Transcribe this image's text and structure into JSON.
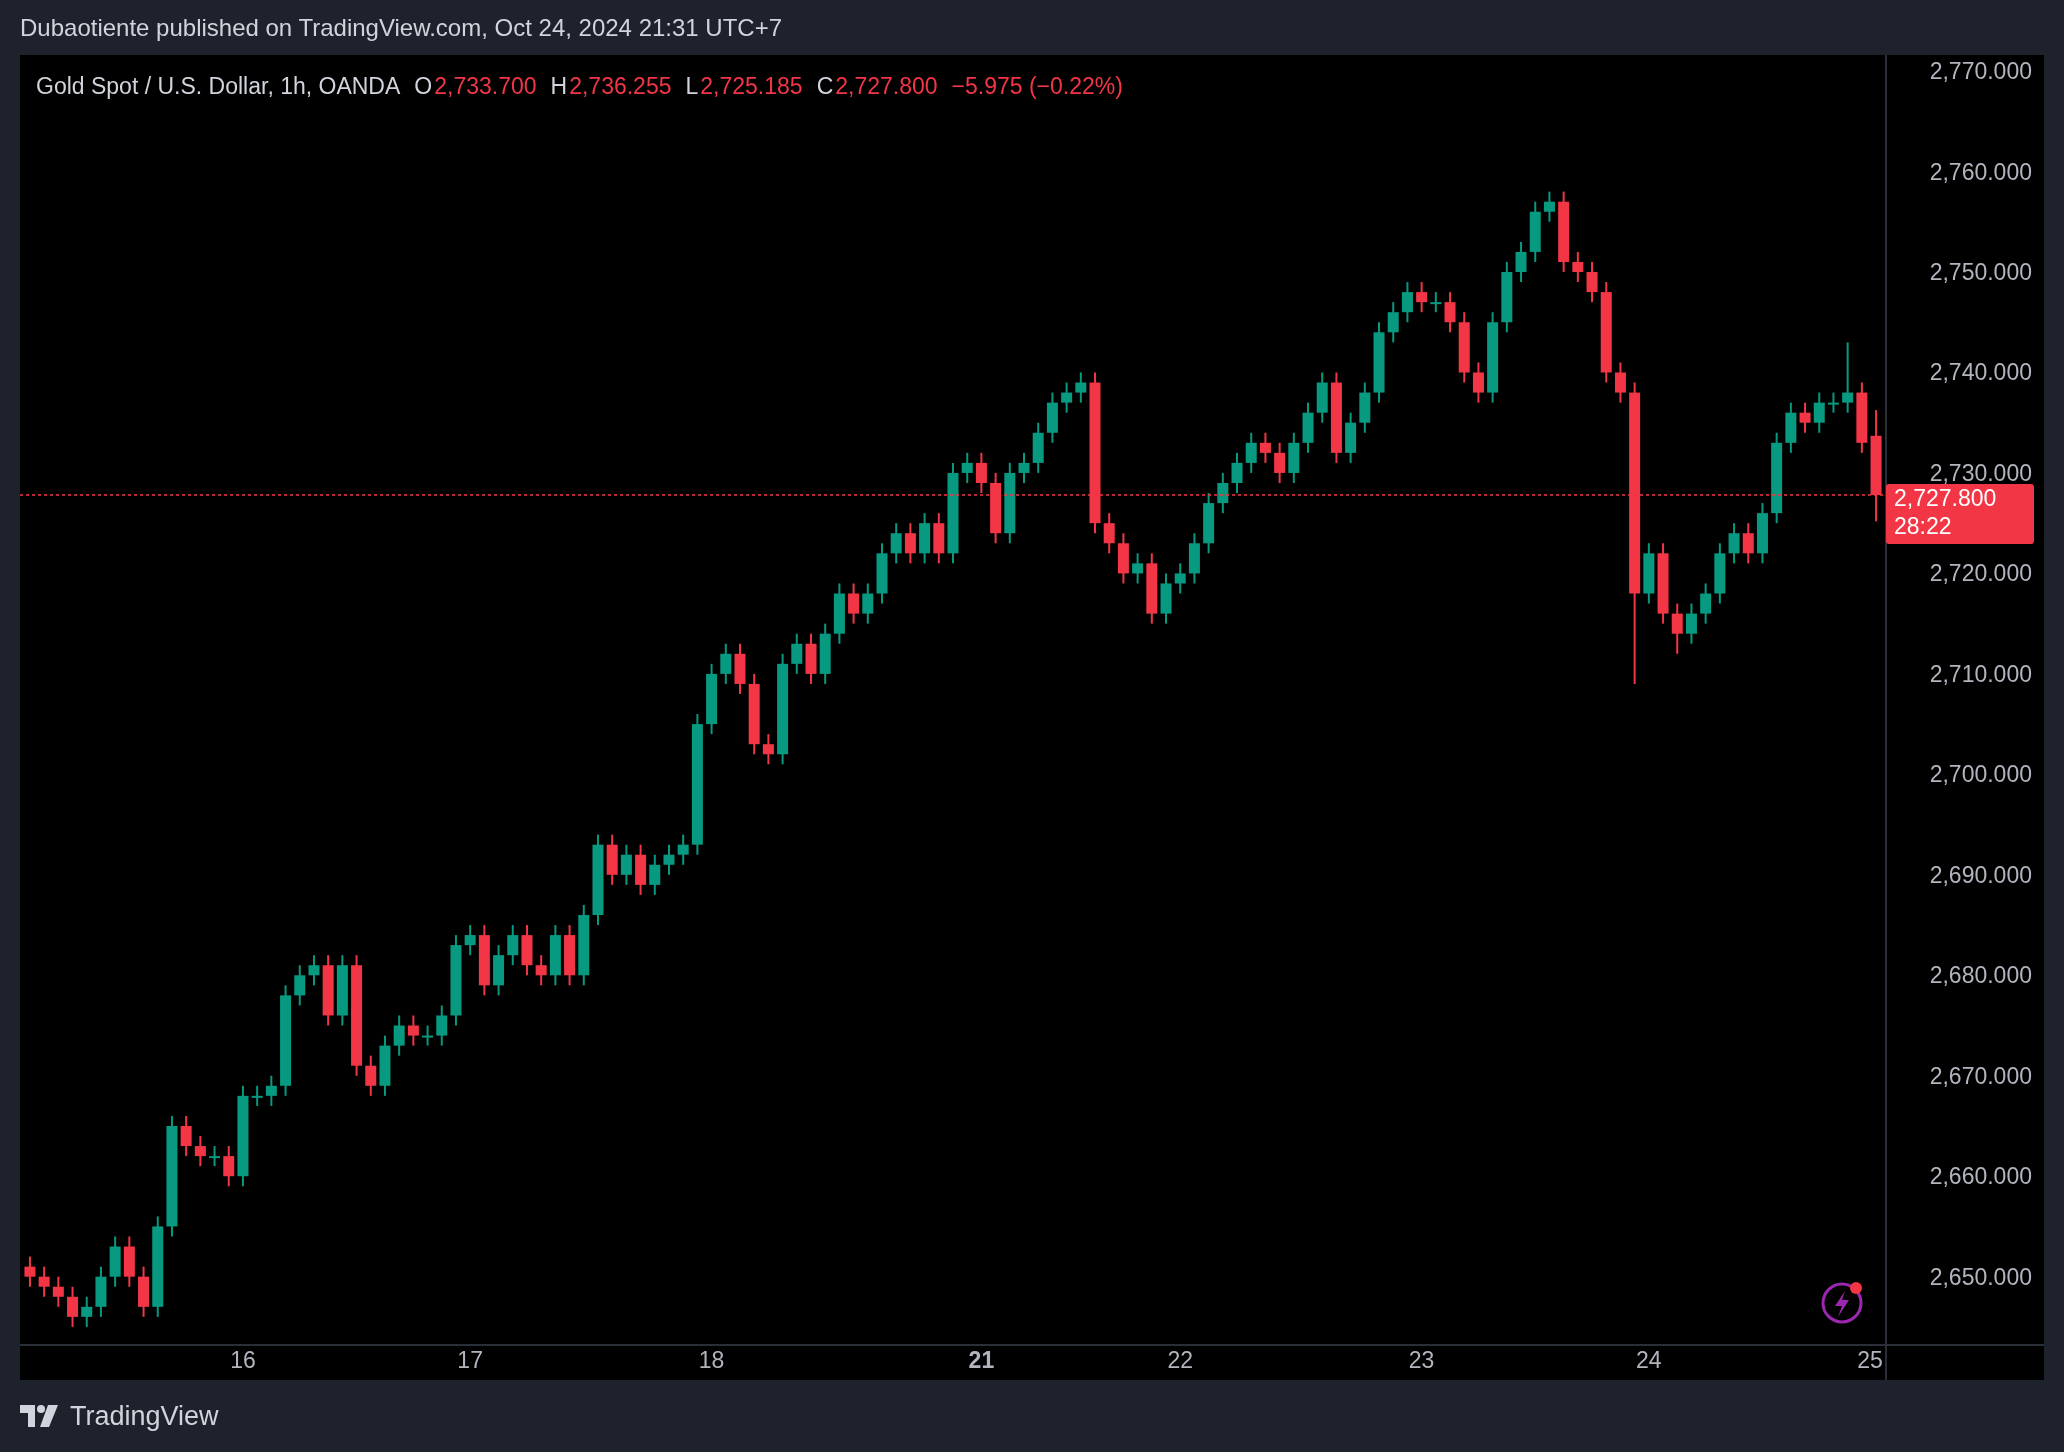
{
  "header": {
    "text": "Dubaotiente published on TradingView.com, Oct 24, 2024 21:31 UTC+7"
  },
  "legend": {
    "symbol": "Gold Spot / U.S. Dollar, 1h, OANDA",
    "fields": [
      {
        "key": "O",
        "value": "2,733.700"
      },
      {
        "key": "H",
        "value": "2,736.255"
      },
      {
        "key": "L",
        "value": "2,725.185"
      },
      {
        "key": "C",
        "value": "2,727.800"
      }
    ],
    "change": "−5.975 (−0.22%)"
  },
  "chart": {
    "chart_data": {
      "type": "candlestick",
      "categories": [
        null,
        null,
        null,
        null,
        null,
        null,
        null,
        null,
        null,
        null,
        null,
        null,
        null,
        null,
        null,
        "16",
        null,
        null,
        null,
        null,
        null,
        null,
        null,
        null,
        null,
        null,
        null,
        null,
        null,
        null,
        null,
        "17",
        null,
        null,
        null,
        null,
        null,
        null,
        null,
        null,
        null,
        null,
        null,
        null,
        null,
        null,
        null,
        null,
        "18",
        null,
        null,
        null,
        null,
        null,
        null,
        null,
        null,
        null,
        null,
        null,
        null,
        null,
        null,
        null,
        null,
        null,
        null,
        "21",
        null,
        null,
        null,
        null,
        null,
        null,
        null,
        null,
        null,
        null,
        null,
        null,
        null,
        "22",
        null,
        null,
        null,
        null,
        null,
        null,
        null,
        null,
        null,
        null,
        null,
        null,
        null,
        null,
        null,
        null,
        "23",
        null,
        null,
        null,
        null,
        null,
        null,
        null,
        null,
        null,
        null,
        null,
        null,
        null,
        null,
        null,
        "24",
        null,
        null,
        null,
        null,
        null,
        null,
        null,
        null,
        null,
        null,
        null,
        null,
        null,
        null,
        null,
        "25"
      ],
      "ohlc": [
        [
          2651,
          2652,
          2649,
          2650
        ],
        [
          2650,
          2651,
          2648,
          2649
        ],
        [
          2649,
          2650,
          2647,
          2648
        ],
        [
          2648,
          2649,
          2645,
          2646
        ],
        [
          2646,
          2648,
          2645,
          2647
        ],
        [
          2647,
          2651,
          2646,
          2650
        ],
        [
          2650,
          2654,
          2649,
          2653
        ],
        [
          2653,
          2654,
          2649,
          2650
        ],
        [
          2650,
          2651,
          2646,
          2647
        ],
        [
          2647,
          2656,
          2646,
          2655
        ],
        [
          2655,
          2666,
          2654,
          2665
        ],
        [
          2665,
          2666,
          2662,
          2663
        ],
        [
          2663,
          2664,
          2661,
          2662
        ],
        [
          2662,
          2663,
          2661,
          2662
        ],
        [
          2662,
          2663,
          2659,
          2660
        ],
        [
          2660,
          2669,
          2659,
          2668
        ],
        [
          2668,
          2669,
          2667,
          2668
        ],
        [
          2668,
          2670,
          2667,
          2669
        ],
        [
          2669,
          2679,
          2668,
          2678
        ],
        [
          2678,
          2681,
          2677,
          2680
        ],
        [
          2680,
          2682,
          2679,
          2681
        ],
        [
          2681,
          2682,
          2675,
          2676
        ],
        [
          2676,
          2682,
          2675,
          2681
        ],
        [
          2681,
          2682,
          2670,
          2671
        ],
        [
          2671,
          2672,
          2668,
          2669
        ],
        [
          2669,
          2674,
          2668,
          2673
        ],
        [
          2673,
          2676,
          2672,
          2675
        ],
        [
          2675,
          2676,
          2673,
          2674
        ],
        [
          2674,
          2675,
          2673,
          2674
        ],
        [
          2674,
          2677,
          2673,
          2676
        ],
        [
          2676,
          2684,
          2675,
          2683
        ],
        [
          2683,
          2685,
          2682,
          2684
        ],
        [
          2684,
          2685,
          2678,
          2679
        ],
        [
          2679,
          2683,
          2678,
          2682
        ],
        [
          2682,
          2685,
          2681,
          2684
        ],
        [
          2684,
          2685,
          2680,
          2681
        ],
        [
          2681,
          2682,
          2679,
          2680
        ],
        [
          2680,
          2685,
          2679,
          2684
        ],
        [
          2684,
          2685,
          2679,
          2680
        ],
        [
          2680,
          2687,
          2679,
          2686
        ],
        [
          2686,
          2694,
          2685,
          2693
        ],
        [
          2693,
          2694,
          2689,
          2690
        ],
        [
          2690,
          2693,
          2689,
          2692
        ],
        [
          2692,
          2693,
          2688,
          2689
        ],
        [
          2689,
          2692,
          2688,
          2691
        ],
        [
          2691,
          2693,
          2690,
          2692
        ],
        [
          2692,
          2694,
          2691,
          2693
        ],
        [
          2693,
          2706,
          2692,
          2705
        ],
        [
          2705,
          2711,
          2704,
          2710
        ],
        [
          2710,
          2713,
          2709,
          2712
        ],
        [
          2712,
          2713,
          2708,
          2709
        ],
        [
          2709,
          2710,
          2702,
          2703
        ],
        [
          2703,
          2704,
          2701,
          2702
        ],
        [
          2702,
          2712,
          2701,
          2711
        ],
        [
          2711,
          2714,
          2710,
          2713
        ],
        [
          2713,
          2714,
          2709,
          2710
        ],
        [
          2710,
          2715,
          2709,
          2714
        ],
        [
          2714,
          2719,
          2713,
          2718
        ],
        [
          2718,
          2719,
          2715,
          2716
        ],
        [
          2716,
          2719,
          2715,
          2718
        ],
        [
          2718,
          2723,
          2717,
          2722
        ],
        [
          2722,
          2725,
          2721,
          2724
        ],
        [
          2724,
          2725,
          2721,
          2722
        ],
        [
          2722,
          2726,
          2721,
          2725
        ],
        [
          2725,
          2726,
          2721,
          2722
        ],
        [
          2722,
          2731,
          2721,
          2730
        ],
        [
          2730,
          2732,
          2729,
          2731
        ],
        [
          2731,
          2732,
          2728,
          2729
        ],
        [
          2729,
          2730,
          2723,
          2724
        ],
        [
          2724,
          2731,
          2723,
          2730
        ],
        [
          2730,
          2732,
          2729,
          2731
        ],
        [
          2731,
          2735,
          2730,
          2734
        ],
        [
          2734,
          2738,
          2733,
          2737
        ],
        [
          2737,
          2739,
          2736,
          2738
        ],
        [
          2738,
          2740,
          2737,
          2739
        ],
        [
          2739,
          2740,
          2724,
          2725
        ],
        [
          2725,
          2726,
          2722,
          2723
        ],
        [
          2723,
          2724,
          2719,
          2720
        ],
        [
          2720,
          2722,
          2719,
          2721
        ],
        [
          2721,
          2722,
          2715,
          2716
        ],
        [
          2716,
          2720,
          2715,
          2719
        ],
        [
          2719,
          2721,
          2718,
          2720
        ],
        [
          2720,
          2724,
          2719,
          2723
        ],
        [
          2723,
          2728,
          2722,
          2727
        ],
        [
          2727,
          2730,
          2726,
          2729
        ],
        [
          2729,
          2732,
          2728,
          2731
        ],
        [
          2731,
          2734,
          2730,
          2733
        ],
        [
          2733,
          2734,
          2731,
          2732
        ],
        [
          2732,
          2733,
          2729,
          2730
        ],
        [
          2730,
          2734,
          2729,
          2733
        ],
        [
          2733,
          2737,
          2732,
          2736
        ],
        [
          2736,
          2740,
          2735,
          2739
        ],
        [
          2739,
          2740,
          2731,
          2732
        ],
        [
          2732,
          2736,
          2731,
          2735
        ],
        [
          2735,
          2739,
          2734,
          2738
        ],
        [
          2738,
          2745,
          2737,
          2744
        ],
        [
          2744,
          2747,
          2743,
          2746
        ],
        [
          2746,
          2749,
          2745,
          2748
        ],
        [
          2748,
          2749,
          2746,
          2747
        ],
        [
          2747,
          2748,
          2746,
          2747
        ],
        [
          2747,
          2748,
          2744,
          2745
        ],
        [
          2745,
          2746,
          2739,
          2740
        ],
        [
          2740,
          2741,
          2737,
          2738
        ],
        [
          2738,
          2746,
          2737,
          2745
        ],
        [
          2745,
          2751,
          2744,
          2750
        ],
        [
          2750,
          2753,
          2749,
          2752
        ],
        [
          2752,
          2757,
          2751,
          2756
        ],
        [
          2756,
          2758,
          2755,
          2757
        ],
        [
          2757,
          2758,
          2750,
          2751
        ],
        [
          2751,
          2752,
          2749,
          2750
        ],
        [
          2750,
          2751,
          2747,
          2748
        ],
        [
          2748,
          2749,
          2739,
          2740
        ],
        [
          2740,
          2741,
          2737,
          2738
        ],
        [
          2738,
          2739,
          2709,
          2718
        ],
        [
          2718,
          2723,
          2717,
          2722
        ],
        [
          2722,
          2723,
          2715,
          2716
        ],
        [
          2716,
          2717,
          2712,
          2714
        ],
        [
          2714,
          2717,
          2713,
          2716
        ],
        [
          2716,
          2719,
          2715,
          2718
        ],
        [
          2718,
          2723,
          2717,
          2722
        ],
        [
          2722,
          2725,
          2721,
          2724
        ],
        [
          2724,
          2725,
          2721,
          2722
        ],
        [
          2722,
          2727,
          2721,
          2726
        ],
        [
          2726,
          2734,
          2725,
          2733
        ],
        [
          2733,
          2737,
          2732,
          2736
        ],
        [
          2736,
          2737,
          2734,
          2735
        ],
        [
          2735,
          2738,
          2734,
          2737
        ],
        [
          2737,
          2738,
          2736,
          2737
        ],
        [
          2737,
          2743,
          2736,
          2738
        ],
        [
          2738,
          2739,
          2732,
          2733
        ],
        [
          2733.7,
          2736.255,
          2725.185,
          2727.8
        ]
      ],
      "ylim": [
        2643.2,
        2771.6
      ],
      "yticks": [
        {
          "value": 2650,
          "label": "2,650.000"
        },
        {
          "value": 2660,
          "label": "2,660.000"
        },
        {
          "value": 2670,
          "label": "2,670.000"
        },
        {
          "value": 2680,
          "label": "2,680.000"
        },
        {
          "value": 2690,
          "label": "2,690.000"
        },
        {
          "value": 2700,
          "label": "2,700.000"
        },
        {
          "value": 2710,
          "label": "2,710.000"
        },
        {
          "value": 2720,
          "label": "2,720.000"
        },
        {
          "value": 2730,
          "label": "2,730.000"
        },
        {
          "value": 2740,
          "label": "2,740.000"
        },
        {
          "value": 2750,
          "label": "2,750.000"
        },
        {
          "value": 2760,
          "label": "2,760.000"
        },
        {
          "value": 2770,
          "label": "2,770.000"
        }
      ]
    }
  },
  "price_label": {
    "price": "2,727.800",
    "countdown": "28:22"
  },
  "footer": {
    "brand": "TradingView"
  }
}
